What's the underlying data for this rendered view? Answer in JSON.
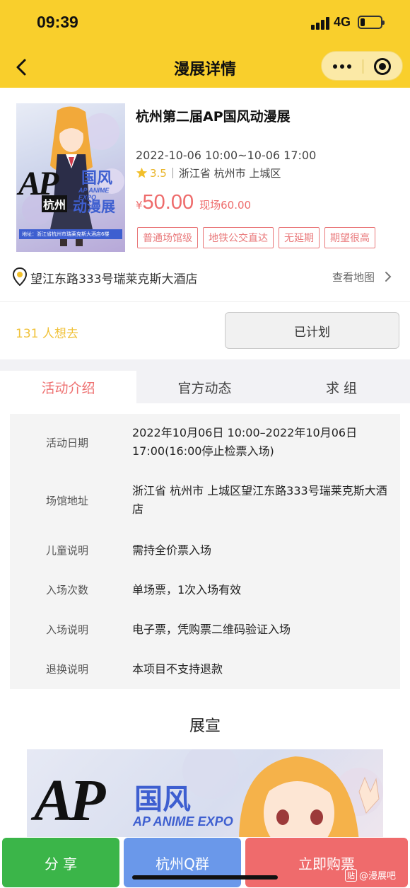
{
  "status_bar": {
    "time": "09:39",
    "network": "4G",
    "battery_level": 0.2
  },
  "nav": {
    "title": "漫展详情",
    "back_icon": "chevron-left-icon",
    "more_icon": "more-dots-icon",
    "close_icon": "target-close-icon"
  },
  "event": {
    "poster": {
      "logo": "AP",
      "logo_sub": "国风",
      "city": "杭州",
      "logo2": "动漫展",
      "en": "AP ANIME EXPO",
      "address_strip": "地址：浙江省杭州市瑞莱克斯大酒店6楼"
    },
    "title": "杭州第二届AP国风动漫展",
    "datetime": "2022-10-06 10:00~10-06 17:00",
    "rating": "3.5",
    "location": "浙江省 杭州市 上城区",
    "currency": "¥",
    "price": "50.00",
    "onsite_price": "现场60.00",
    "tags": [
      "普通场馆级",
      "地铁公交直达",
      "无延期",
      "期望很高"
    ]
  },
  "address": {
    "text": "望江东路333号瑞莱克斯大酒店",
    "map_link": "查看地图"
  },
  "interest": {
    "count_text": "131 人想去",
    "plan_button": "已计划"
  },
  "tabs": [
    {
      "label": "活动介绍",
      "active": true
    },
    {
      "label": "官方动态",
      "active": false
    },
    {
      "label": "求 组",
      "active": false
    }
  ],
  "info": [
    {
      "key": "活动日期",
      "value": "2022年10月06日 10:00–2022年10月06日 17:00(16:00停止检票入场)"
    },
    {
      "key": "场馆地址",
      "value": "浙江省 杭州市 上城区望江东路333号瑞莱克斯大酒店"
    },
    {
      "key": "儿童说明",
      "value": "需持全价票入场"
    },
    {
      "key": "入场次数",
      "value": "单场票，1次入场有效"
    },
    {
      "key": "入场说明",
      "value": "电子票，凭购票二维码验证入场"
    },
    {
      "key": "退换说明",
      "value": "本项目不支持退款"
    }
  ],
  "promo": {
    "title": "展宣",
    "banner_logo": "AP",
    "banner_logo2": "国风",
    "banner_en": "AP ANIME EXPO"
  },
  "bottom_bar": {
    "share": "分 享",
    "group": "杭州Q群",
    "buy": "立即购票"
  },
  "watermark": {
    "badge": "贴",
    "text": "@漫展吧"
  },
  "colors": {
    "brand_yellow": "#f9cf2c",
    "price_red": "#ee6b6c",
    "share_green": "#3bb549",
    "group_blue": "#6a98ea"
  }
}
